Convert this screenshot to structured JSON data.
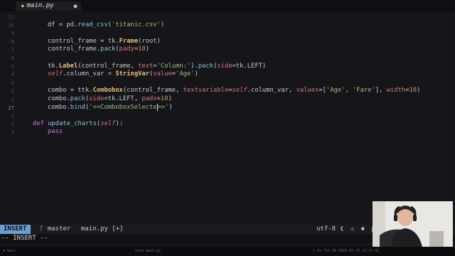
{
  "tab": {
    "filename": "main.py"
  },
  "lines": [
    {
      "num": "11",
      "tokens": []
    },
    {
      "num": "10",
      "tokens": [
        {
          "t": "df = pd.",
          "c": "plain"
        },
        {
          "t": "read_csv",
          "c": "fn"
        },
        {
          "t": "(",
          "c": "plain"
        },
        {
          "t": "'titanic.csv'",
          "c": "str"
        },
        {
          "t": ")",
          "c": "plain"
        }
      ]
    },
    {
      "num": "9",
      "tokens": []
    },
    {
      "num": "8",
      "tokens": [
        {
          "t": "control_frame = tk.",
          "c": "plain"
        },
        {
          "t": "Frame",
          "c": "cls"
        },
        {
          "t": "(root)",
          "c": "plain"
        }
      ]
    },
    {
      "num": "7",
      "tokens": [
        {
          "t": "control_frame.",
          "c": "plain"
        },
        {
          "t": "pack",
          "c": "fn"
        },
        {
          "t": "(",
          "c": "plain"
        },
        {
          "t": "pady",
          "c": "param"
        },
        {
          "t": "=",
          "c": "plain"
        },
        {
          "t": "10",
          "c": "num"
        },
        {
          "t": ")",
          "c": "plain"
        }
      ]
    },
    {
      "num": "6",
      "tokens": []
    },
    {
      "num": "5",
      "tokens": [
        {
          "t": "tk.",
          "c": "plain"
        },
        {
          "t": "Label",
          "c": "cls"
        },
        {
          "t": "(control_frame, ",
          "c": "plain"
        },
        {
          "t": "text",
          "c": "param"
        },
        {
          "t": "=",
          "c": "plain"
        },
        {
          "t": "'Column:'",
          "c": "str"
        },
        {
          "t": ").",
          "c": "plain"
        },
        {
          "t": "pack",
          "c": "fn"
        },
        {
          "t": "(",
          "c": "plain"
        },
        {
          "t": "side",
          "c": "param"
        },
        {
          "t": "=tk.LEFT)",
          "c": "plain"
        }
      ]
    },
    {
      "num": "4",
      "tokens": [
        {
          "t": "self",
          "c": "self"
        },
        {
          "t": ".column_var = ",
          "c": "plain"
        },
        {
          "t": "StringVar",
          "c": "cls"
        },
        {
          "t": "(",
          "c": "plain"
        },
        {
          "t": "value",
          "c": "param"
        },
        {
          "t": "=",
          "c": "plain"
        },
        {
          "t": "'Age'",
          "c": "str"
        },
        {
          "t": ")",
          "c": "plain"
        }
      ]
    },
    {
      "num": "3",
      "tokens": []
    },
    {
      "num": "2",
      "tokens": [
        {
          "t": "combo = ttk.",
          "c": "plain"
        },
        {
          "t": "Combobox",
          "c": "cls"
        },
        {
          "t": "(control_frame, ",
          "c": "plain"
        },
        {
          "t": "textvariable",
          "c": "param"
        },
        {
          "t": "=",
          "c": "plain"
        },
        {
          "t": "self",
          "c": "self"
        },
        {
          "t": ".column_var, ",
          "c": "plain"
        },
        {
          "t": "values",
          "c": "param"
        },
        {
          "t": "=[",
          "c": "plain"
        },
        {
          "t": "'Age'",
          "c": "str"
        },
        {
          "t": ", ",
          "c": "plain"
        },
        {
          "t": "'Fare'",
          "c": "str"
        },
        {
          "t": "], ",
          "c": "plain"
        },
        {
          "t": "width",
          "c": "param"
        },
        {
          "t": "=",
          "c": "plain"
        },
        {
          "t": "10",
          "c": "num"
        },
        {
          "t": ")",
          "c": "plain"
        }
      ]
    },
    {
      "num": "1",
      "tokens": [
        {
          "t": "combo.",
          "c": "plain"
        },
        {
          "t": "pack",
          "c": "fn"
        },
        {
          "t": "(",
          "c": "plain"
        },
        {
          "t": "side",
          "c": "param"
        },
        {
          "t": "=tk.LEFT, ",
          "c": "plain"
        },
        {
          "t": "padx",
          "c": "param"
        },
        {
          "t": "=",
          "c": "plain"
        },
        {
          "t": "10",
          "c": "num"
        },
        {
          "t": ")",
          "c": "plain"
        }
      ]
    },
    {
      "num": "27",
      "current": true,
      "tokens": [
        {
          "t": "combo.",
          "c": "plain"
        },
        {
          "t": "bind",
          "c": "fn"
        },
        {
          "t": "(",
          "c": "plain"
        },
        {
          "t": "'<<ComboboxSelecte",
          "c": "str"
        },
        {
          "t": "",
          "c": "cursor"
        },
        {
          "t": ">>'",
          "c": "str"
        },
        {
          "t": ")",
          "c": "plain"
        }
      ]
    },
    {
      "num": "1",
      "tokens": []
    },
    {
      "num": "2",
      "tokens": [
        {
          "t": "def ",
          "c": "kw"
        },
        {
          "t": "update_charts",
          "c": "fn"
        },
        {
          "t": "(",
          "c": "plain"
        },
        {
          "t": "self",
          "c": "self"
        },
        {
          "t": "):",
          "c": "plain"
        }
      ]
    },
    {
      "num": "3",
      "tokens": [
        {
          "t": "pass",
          "c": "kw"
        }
      ]
    }
  ],
  "statusbar": {
    "mode": "INSERT",
    "branch": "master",
    "file": "main.py [+]",
    "encoding": "utf-8",
    "right_icons": "❮ ⚠ ◆ p"
  },
  "cmdline": {
    "text": "-- INSERT --"
  },
  "bottombar": {
    "left": "▪ main",
    "mid": "nvim main.py",
    "right": "/ 1%  755  0B  2025-01-15 21:11:42"
  },
  "colors": {
    "mode_bg": "#6a9fd4",
    "editor_bg": "#15151a"
  }
}
